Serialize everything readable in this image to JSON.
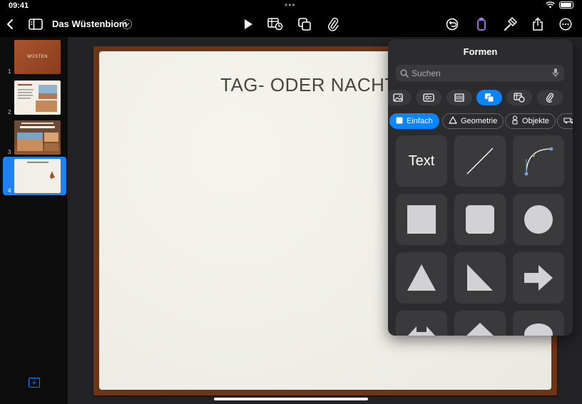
{
  "status_bar": {
    "time": "09:41"
  },
  "toolbar": {
    "document_title": "Das Wüstenbiom",
    "active_color": "#a874f9"
  },
  "navigator": {
    "slides": [
      {
        "number": "1",
        "thumb_text": "WÜSTEN"
      },
      {
        "number": "2",
        "thumb_text": ""
      },
      {
        "number": "3",
        "thumb_text": ""
      },
      {
        "number": "4",
        "thumb_text": ""
      }
    ],
    "selected": 4
  },
  "slide": {
    "title": "TAG- ODER NACHTA"
  },
  "popover": {
    "title": "Formen",
    "search_placeholder": "Suchen",
    "categories": [
      "photo-icon",
      "media-icon",
      "texture-icon",
      "shapes-icon",
      "chart-icon",
      "paperclip-icon"
    ],
    "active_category": "shapes-icon",
    "subcategories": [
      {
        "label": "Einfach",
        "icon": "square-icon",
        "active": true
      },
      {
        "label": "Geometrie",
        "icon": "triangle-outline-icon",
        "active": false
      },
      {
        "label": "Objekte",
        "icon": "objects-icon",
        "active": false
      }
    ],
    "tiles": {
      "text_label": "Text"
    }
  },
  "colors": {
    "accent": "#0a84ff",
    "slide_frame": "#6e3418",
    "popover_bg": "#2c2c2e",
    "tile_bg": "#3a3a3c"
  }
}
